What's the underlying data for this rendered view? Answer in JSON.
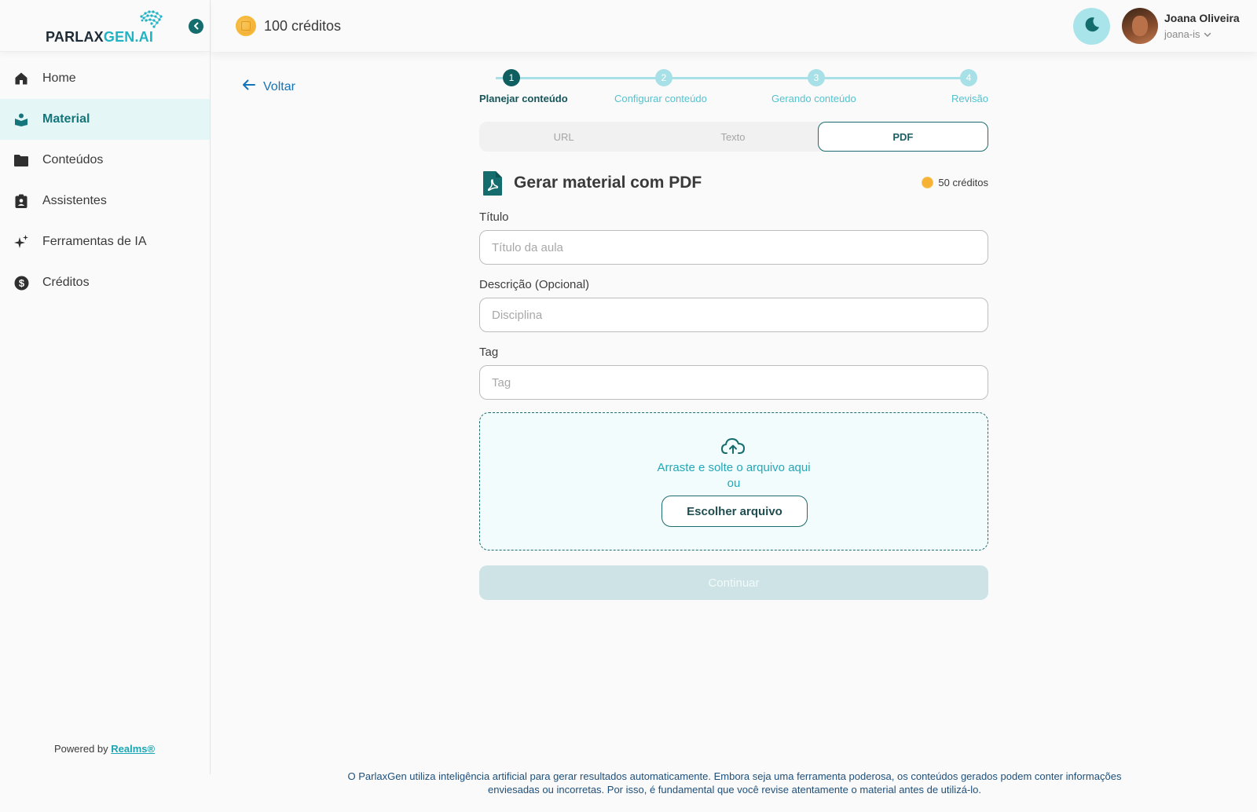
{
  "brand": {
    "logo_main": "PARLAX",
    "logo_accent": "GEN.AI"
  },
  "sidebar": {
    "items": [
      {
        "label": "Home",
        "icon": "home-icon",
        "active": false
      },
      {
        "label": "Material",
        "icon": "material-icon",
        "active": true
      },
      {
        "label": "Conteúdos",
        "icon": "folder-icon",
        "active": false
      },
      {
        "label": "Assistentes",
        "icon": "assistant-badge-icon",
        "active": false
      },
      {
        "label": "Ferramentas de IA",
        "icon": "sparkle-icon",
        "active": false
      },
      {
        "label": "Créditos",
        "icon": "dollar-circle-icon",
        "active": false
      }
    ],
    "powered_prefix": "Powered by",
    "powered_link": "Realms®"
  },
  "header": {
    "credits": "100 créditos",
    "user_name": "Joana Oliveira",
    "user_handle": "joana-is"
  },
  "main": {
    "back_label": "Voltar",
    "steps": [
      {
        "number": "1",
        "label": "Planejar conteúdo",
        "active": true
      },
      {
        "number": "2",
        "label": "Configurar conteúdo",
        "active": false
      },
      {
        "number": "3",
        "label": "Gerando conteúdo",
        "active": false
      },
      {
        "number": "4",
        "label": "Revisão",
        "active": false
      }
    ],
    "tabs": [
      {
        "label": "URL",
        "active": false
      },
      {
        "label": "Texto",
        "active": false
      },
      {
        "label": "PDF",
        "active": true
      }
    ],
    "form_title": "Gerar material com PDF",
    "cost": "50 créditos",
    "fields": {
      "title_label": "Título",
      "title_placeholder": "Título da aula",
      "title_value": "",
      "description_label": "Descrição (Opcional)",
      "description_placeholder": "Disciplina",
      "description_value": "",
      "tag_label": "Tag",
      "tag_placeholder": "Tag",
      "tag_value": ""
    },
    "dropzone": {
      "line1": "Arraste e solte o arquivo aqui",
      "line2": "ou",
      "button": "Escolher arquivo"
    },
    "continue_label": "Continuar"
  },
  "footer": {
    "disclaimer_line1": "O ParlaxGen utiliza inteligência artificial para gerar resultados automaticamente. Embora seja uma ferramenta poderosa, os conteúdos gerados podem conter informações",
    "disclaimer_line2": "enviesadas ou incorretas. Por isso, é fundamental que você revise atentamente o material antes de utilizá-lo."
  },
  "colors": {
    "brand_teal": "#146c6c",
    "accent_cyan": "#1fb3c4",
    "active_bg": "#e5f6f7",
    "link_blue": "#1673b7",
    "coin_gold": "#f5b234"
  }
}
